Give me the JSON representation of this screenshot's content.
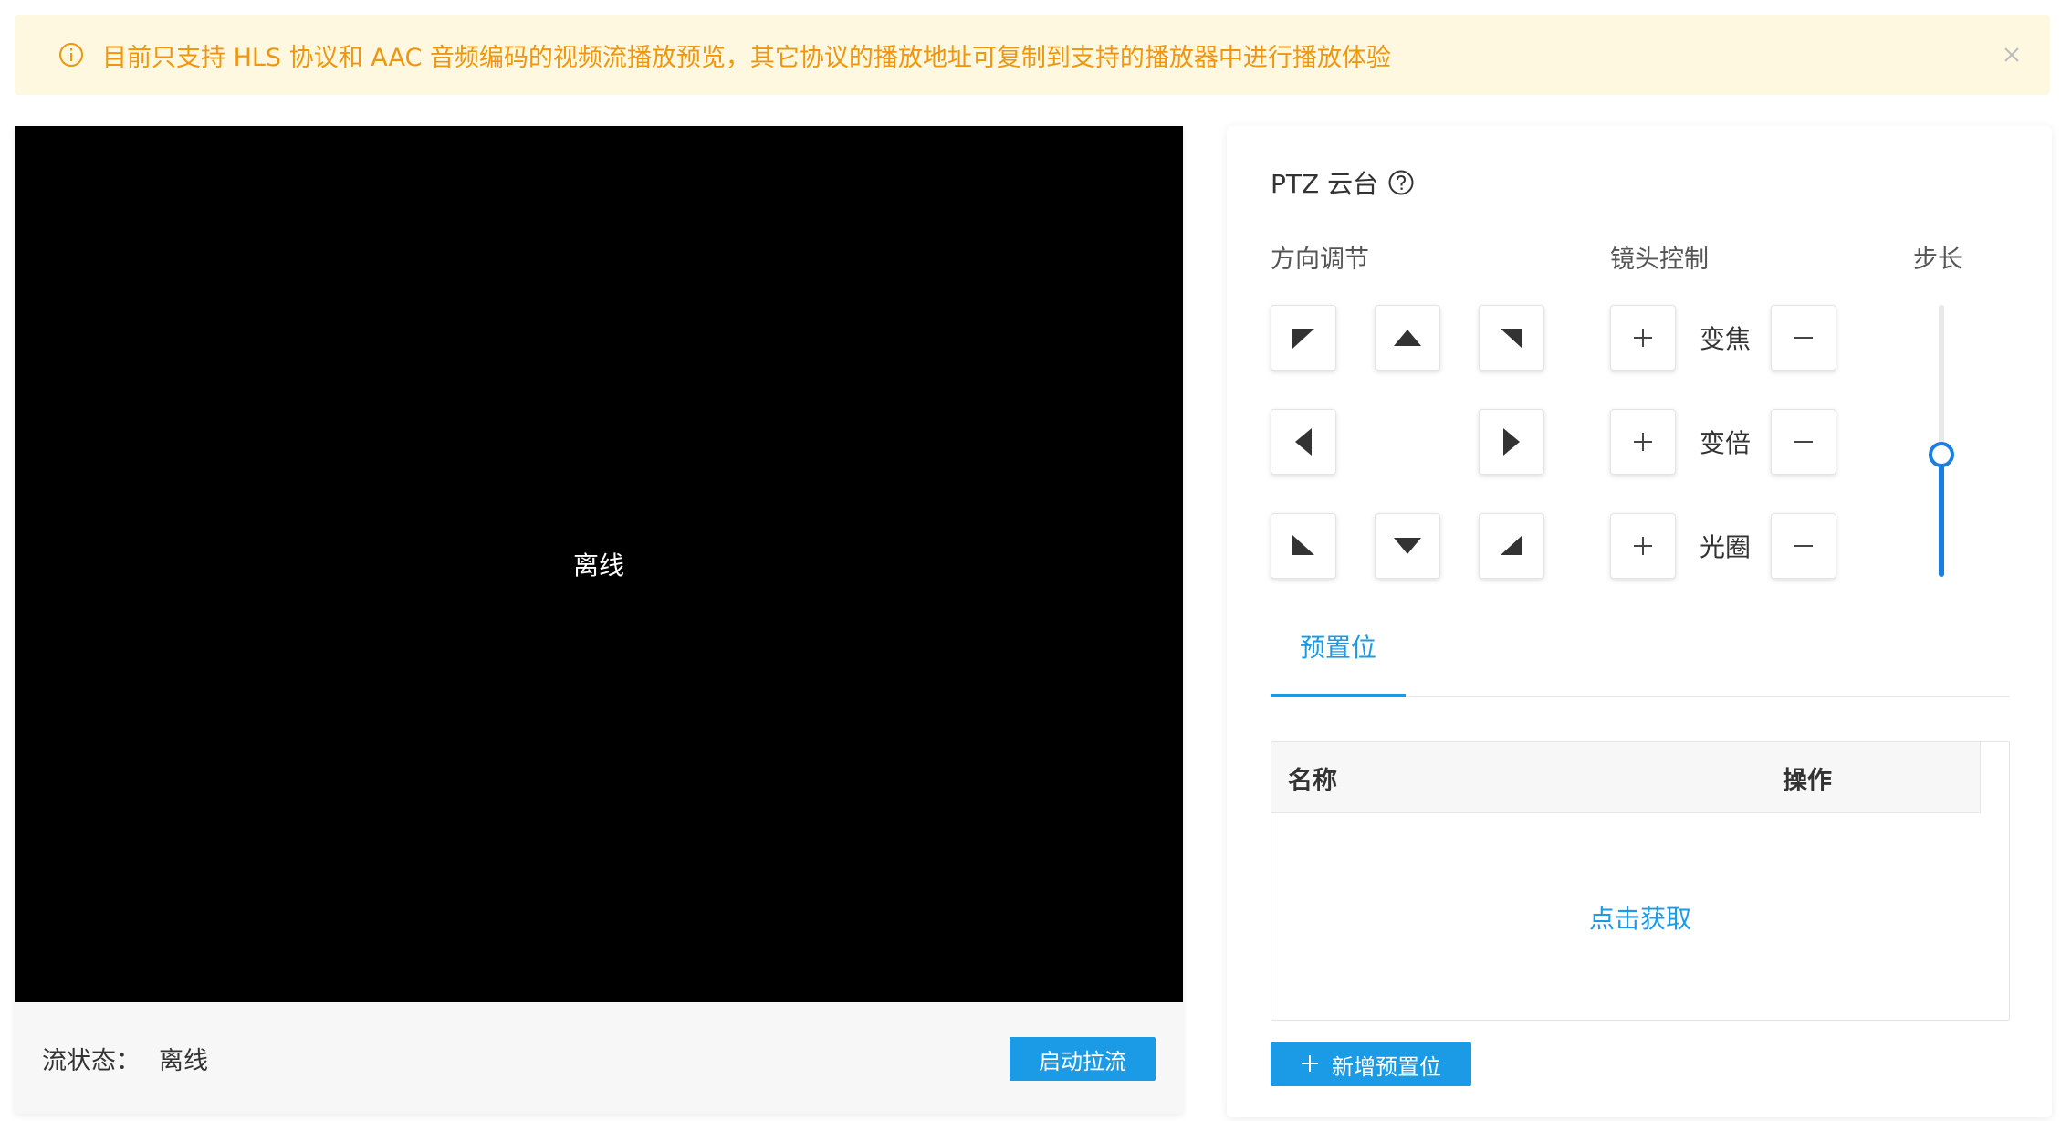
{
  "alert": {
    "icon": "info-circle-icon",
    "message": "目前只支持 HLS 协议和 AAC 音频编码的视频流播放预览，其它协议的播放地址可复制到支持的播放器中进行播放体验",
    "close_icon": "close-icon",
    "color": "#f0960e",
    "background": "#fef8e1"
  },
  "video": {
    "screen_text": "离线",
    "status_label": "流状态：",
    "status_value": "离线",
    "start_button": "启动拉流"
  },
  "ptz": {
    "title": "PTZ 云台",
    "help_icon": "question-circle-icon",
    "direction_label": "方向调节",
    "lens_label": "镜头控制",
    "step_label": "步长",
    "direction_buttons": [
      "up-left",
      "up",
      "up-right",
      "left",
      "right",
      "down-left",
      "down",
      "down-right"
    ],
    "lens": [
      {
        "name": "变焦"
      },
      {
        "name": "变倍"
      },
      {
        "name": "光圈"
      }
    ],
    "step_level_fraction": 0.45,
    "accent": "#1b9ae6"
  },
  "presets": {
    "tab_label": "预置位",
    "columns": [
      "名称",
      "操作"
    ],
    "fetch_link": "点击获取",
    "add_button": "新增预置位"
  }
}
